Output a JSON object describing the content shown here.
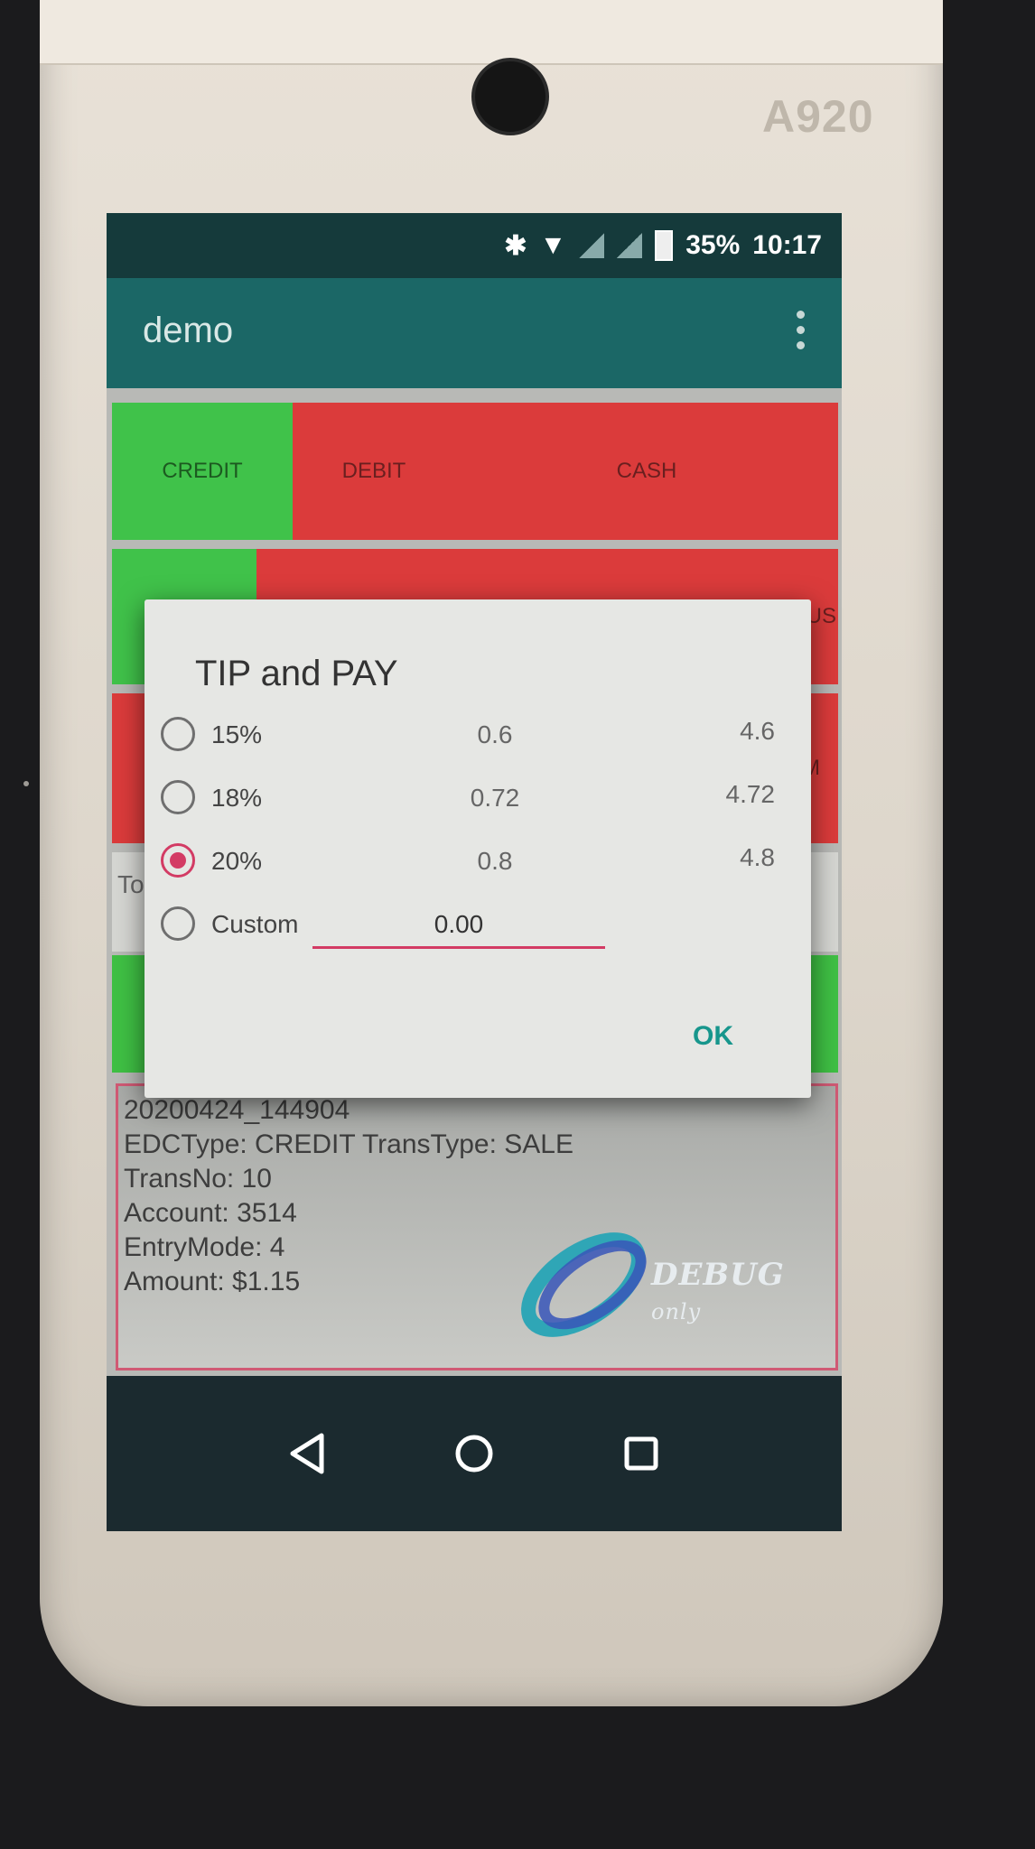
{
  "device": {
    "model": "A920"
  },
  "status_bar": {
    "battery": "35%",
    "time": "10:17"
  },
  "app_bar": {
    "title": "demo"
  },
  "payment_buttons": [
    "CREDIT",
    "DEBIT",
    "CASH"
  ],
  "row2_partial": "US",
  "row3_partial": "M",
  "to_partial": "To",
  "log": {
    "lines": [
      "20200424_144904",
      "EDCType: CREDIT TransType: SALE",
      "TransNo: 10",
      "Account: 3514",
      "EntryMode: 4",
      "Amount: $1.15"
    ],
    "watermark": "DEBUG",
    "watermark_suffix": "only"
  },
  "dialog": {
    "title": "TIP and PAY",
    "options": [
      {
        "label": "15%",
        "tip": "0.6",
        "total": "4.6",
        "selected": false
      },
      {
        "label": "18%",
        "tip": "0.72",
        "total": "4.72",
        "selected": false
      },
      {
        "label": "20%",
        "tip": "0.8",
        "total": "4.8",
        "selected": true
      },
      {
        "label": "Custom",
        "value": "0.00",
        "selected": false
      }
    ],
    "ok_label": "OK"
  },
  "colors": {
    "accent": "#d33b64",
    "ok": "#17968c",
    "appbar": "#1b6766",
    "green": "#40c24a",
    "red": "#db3b3b"
  }
}
